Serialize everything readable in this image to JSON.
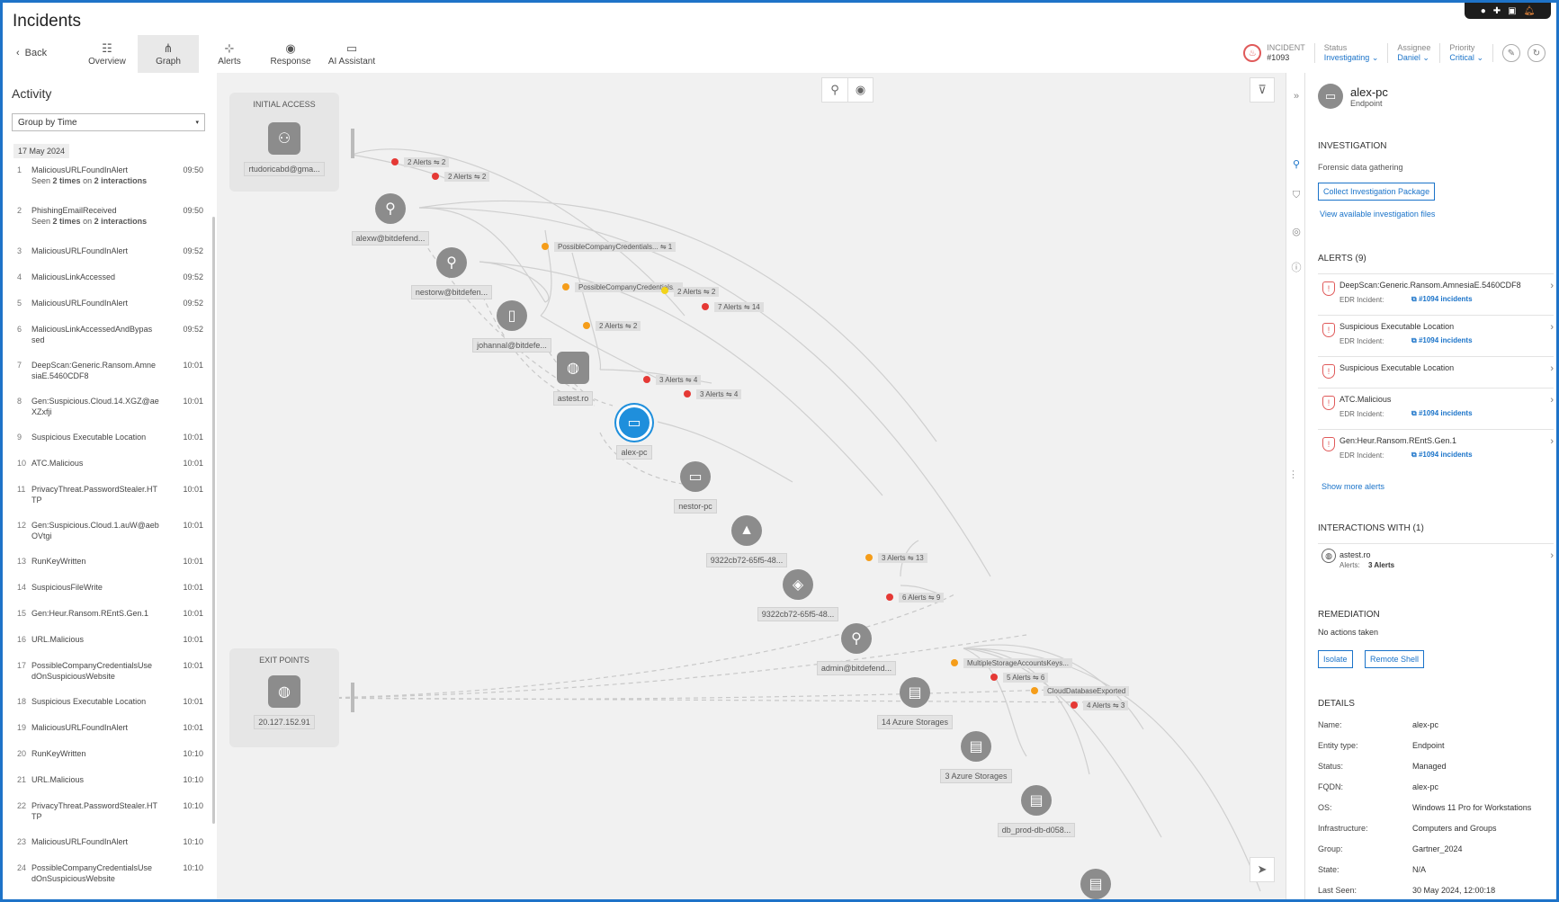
{
  "header": {
    "title": "Incidents",
    "back_label": "Back",
    "tabs": [
      {
        "label": "Overview",
        "icon": "list-icon"
      },
      {
        "label": "Graph",
        "icon": "graph-icon"
      },
      {
        "label": "Alerts",
        "icon": "alerts-icon"
      },
      {
        "label": "Response",
        "icon": "response-icon"
      },
      {
        "label": "AI Assistant",
        "icon": "chat-icon"
      }
    ],
    "incident_label": "INCIDENT",
    "incident_id": "#1093",
    "status_label": "Status",
    "status_value": "Investigating",
    "assignee_label": "Assignee",
    "assignee_value": "Daniel",
    "priority_label": "Priority",
    "priority_value": "Critical"
  },
  "activity": {
    "title": "Activity",
    "group_by": "Group by Time",
    "date": "17 May 2024",
    "items": [
      {
        "n": "1",
        "name": "MaliciousURLFoundInAlert",
        "time": "09:50",
        "sub": "Seen 2 times on 2 interactions"
      },
      {
        "n": "2",
        "name": "PhishingEmailReceived",
        "time": "09:50",
        "sub": "Seen 2 times on 2 interactions"
      },
      {
        "n": "3",
        "name": "MaliciousURLFoundInAlert",
        "time": "09:52",
        "sub": ""
      },
      {
        "n": "4",
        "name": "MaliciousLinkAccessed",
        "time": "09:52",
        "sub": ""
      },
      {
        "n": "5",
        "name": "MaliciousURLFoundInAlert",
        "time": "09:52",
        "sub": ""
      },
      {
        "n": "6",
        "name": "MaliciousLinkAccessedAndBypas sed",
        "time": "09:52",
        "sub": ""
      },
      {
        "n": "7",
        "name": "DeepScan:Generic.Ransom.Amne siaE.5460CDF8",
        "time": "10:01",
        "sub": ""
      },
      {
        "n": "8",
        "name": "Gen:Suspicious.Cloud.14.XGZ@ae XZxfji",
        "time": "10:01",
        "sub": ""
      },
      {
        "n": "9",
        "name": "Suspicious Executable Location",
        "time": "10:01",
        "sub": ""
      },
      {
        "n": "10",
        "name": "ATC.Malicious",
        "time": "10:01",
        "sub": ""
      },
      {
        "n": "11",
        "name": "PrivacyThreat.PasswordStealer.HT TP",
        "time": "10:01",
        "sub": ""
      },
      {
        "n": "12",
        "name": "Gen:Suspicious.Cloud.1.auW@aeb OVtgi",
        "time": "10:01",
        "sub": ""
      },
      {
        "n": "13",
        "name": "RunKeyWritten",
        "time": "10:01",
        "sub": ""
      },
      {
        "n": "14",
        "name": "SuspiciousFileWrite",
        "time": "10:01",
        "sub": ""
      },
      {
        "n": "15",
        "name": "Gen:Heur.Ransom.REntS.Gen.1",
        "time": "10:01",
        "sub": ""
      },
      {
        "n": "16",
        "name": "URL.Malicious",
        "time": "10:01",
        "sub": ""
      },
      {
        "n": "17",
        "name": "PossibleCompanyCredentialsUse dOnSuspiciousWebsite",
        "time": "10:01",
        "sub": ""
      },
      {
        "n": "18",
        "name": "Suspicious Executable Location",
        "time": "10:01",
        "sub": ""
      },
      {
        "n": "19",
        "name": "MaliciousURLFoundInAlert",
        "time": "10:01",
        "sub": ""
      },
      {
        "n": "20",
        "name": "RunKeyWritten",
        "time": "10:10",
        "sub": ""
      },
      {
        "n": "21",
        "name": "URL.Malicious",
        "time": "10:10",
        "sub": ""
      },
      {
        "n": "22",
        "name": "PrivacyThreat.PasswordStealer.HT TP",
        "time": "10:10",
        "sub": ""
      },
      {
        "n": "23",
        "name": "MaliciousURLFoundInAlert",
        "time": "10:10",
        "sub": ""
      },
      {
        "n": "24",
        "name": "PossibleCompanyCredentialsUse dOnSuspiciousWebsite",
        "time": "10:10",
        "sub": ""
      }
    ]
  },
  "graph": {
    "initial_access_label": "INITIAL ACCESS",
    "exit_points_label": "EXIT POINTS",
    "nodes": [
      {
        "label": "rtudoricabd@gma...",
        "icon": "user-unknown-icon"
      },
      {
        "label": "alexw@bitdefend...",
        "icon": "user-icon"
      },
      {
        "label": "nestorw@bitdefen...",
        "icon": "user-icon"
      },
      {
        "label": "johannal@bitdefe...",
        "icon": "mobile-icon"
      },
      {
        "label": "astest.ro",
        "icon": "globe-icon"
      },
      {
        "label": "alex-pc",
        "icon": "desktop-icon"
      },
      {
        "label": "nestor-pc",
        "icon": "desktop-icon"
      },
      {
        "label": "9322cb72-65f5-48...",
        "icon": "cloud-app-icon"
      },
      {
        "label": "9322cb72-65f5-48...",
        "icon": "cloud-resource-icon"
      },
      {
        "label": "admin@bitdefend...",
        "icon": "user-icon"
      },
      {
        "label": "14 Azure Storages",
        "icon": "storage-icon"
      },
      {
        "label": "3 Azure Storages",
        "icon": "storage-icon"
      },
      {
        "label": "db_prod-db-d058...",
        "icon": "storage-icon"
      },
      {
        "label": "20.127.152.91",
        "icon": "globe-icon"
      }
    ],
    "tags": [
      "2 Alerts ⇋ 2",
      "2 Alerts ⇋ 2",
      "PossibleCompanyCredentials... ⇋ 1",
      "PossibleCompanyCredentials...",
      "2 Alerts ⇋ 2",
      "7 Alerts ⇋ 14",
      "2 Alerts ⇋ 2",
      "3 Alerts ⇋ 4",
      "3 Alerts ⇋ 4",
      "3 Alerts ⇋ 13",
      "6 Alerts ⇋ 9",
      "MultipleStorageAccountsKeys...",
      "5 Alerts ⇋ 6",
      "CloudDatabaseExported",
      "4 Alerts ⇋ 3"
    ]
  },
  "panel": {
    "name": "alex-pc",
    "type": "Endpoint",
    "investigation_title": "INVESTIGATION",
    "investigation_sub": "Forensic data gathering",
    "collect_btn": "Collect Investigation Package",
    "view_files": "View available investigation files",
    "alerts_title": "ALERTS (9)",
    "edr_label": "EDR Incident:",
    "alerts": [
      {
        "name": "DeepScan:Generic.Ransom.AmnesiaE.5460CDF8",
        "link": "#1094 incidents"
      },
      {
        "name": "Suspicious Executable Location",
        "link": "#1094 incidents"
      },
      {
        "name": "Suspicious Executable Location",
        "link": ""
      },
      {
        "name": "ATC.Malicious",
        "link": "#1094 incidents"
      },
      {
        "name": "Gen:Heur.Ransom.REntS.Gen.1",
        "link": "#1094 incidents"
      }
    ],
    "show_more": "Show more alerts",
    "interactions_title": "INTERACTIONS WITH (1)",
    "interaction_name": "astest.ro",
    "interaction_alerts_label": "Alerts:",
    "interaction_alerts_value": "3 Alerts",
    "remediation_title": "REMEDIATION",
    "remediation_sub": "No actions taken",
    "isolate_btn": "Isolate",
    "shell_btn": "Remote Shell",
    "details_title": "DETAILS",
    "details": [
      {
        "k": "Name:",
        "v": "alex-pc"
      },
      {
        "k": "Entity type:",
        "v": "Endpoint"
      },
      {
        "k": "Status:",
        "v": "Managed"
      },
      {
        "k": "FQDN:",
        "v": "alex-pc"
      },
      {
        "k": "OS:",
        "v": "Windows 11 Pro for Workstations"
      },
      {
        "k": "Infrastructure:",
        "v": "Computers and Groups"
      },
      {
        "k": "Group:",
        "v": "Gartner_2024"
      },
      {
        "k": "State:",
        "v": "N/A"
      },
      {
        "k": "Last Seen:",
        "v": "30 May 2024, 12:00:18"
      }
    ]
  },
  "colors": {
    "accent": "#1a73c9",
    "alert_red": "#e53935",
    "alert_orange": "#f59d1a",
    "node_gray": "#8c8c8c",
    "selected_node": "#1f8fdc"
  }
}
